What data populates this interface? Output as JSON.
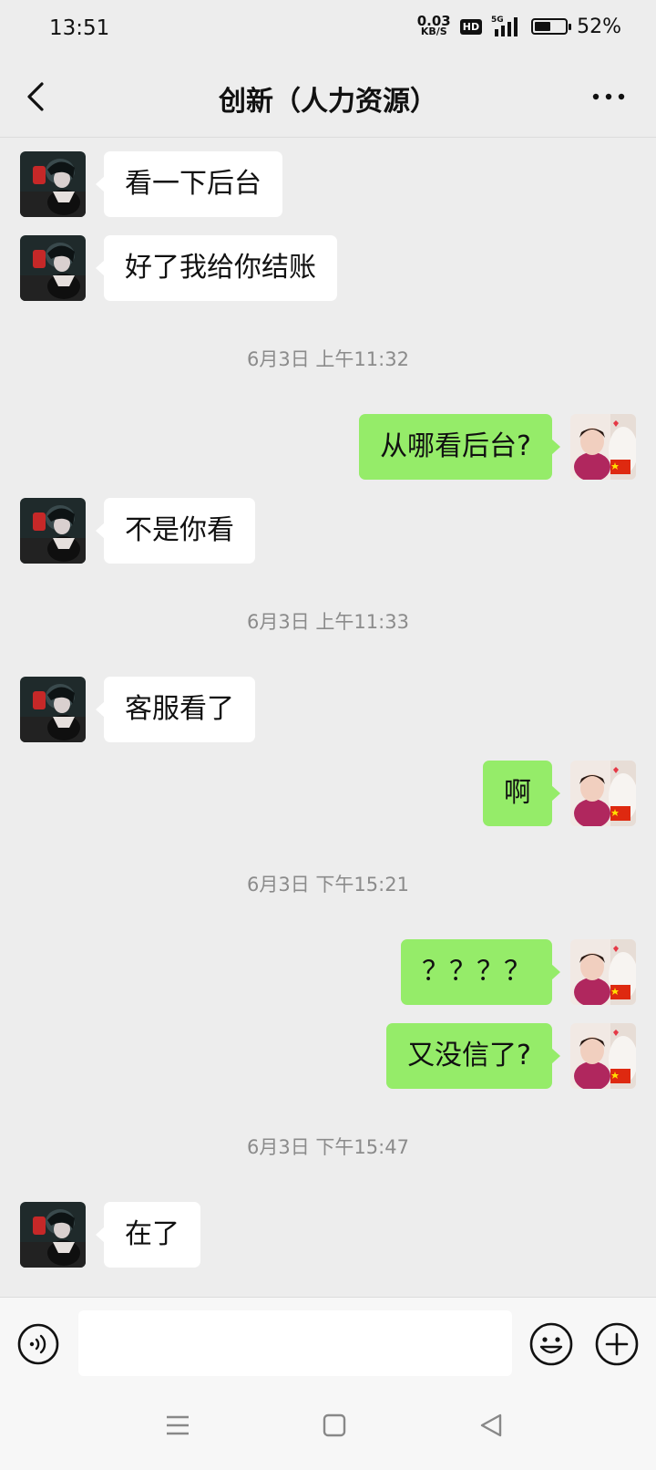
{
  "status_bar": {
    "time": "13:51",
    "net_speed_value": "0.03",
    "net_speed_unit": "KB/S",
    "hd_label": "HD",
    "network_label": "5G",
    "battery_percent": "52%",
    "battery_level": 0.52
  },
  "header": {
    "title": "创新（人力资源）"
  },
  "colors": {
    "background": "#ededed",
    "incoming_bubble": "#ffffff",
    "outgoing_bubble": "#95ec69",
    "timestamp_text": "#8b8b8b"
  },
  "messages": [
    {
      "kind": "incoming",
      "text": "看一下后台"
    },
    {
      "kind": "incoming",
      "text": "好了我给你结账"
    },
    {
      "kind": "timestamp",
      "text": "6月3日 上午11:32"
    },
    {
      "kind": "outgoing",
      "text": "从哪看后台?"
    },
    {
      "kind": "incoming",
      "text": "不是你看"
    },
    {
      "kind": "timestamp",
      "text": "6月3日 上午11:33"
    },
    {
      "kind": "incoming",
      "text": "客服看了"
    },
    {
      "kind": "outgoing",
      "text": "啊"
    },
    {
      "kind": "timestamp",
      "text": "6月3日 下午15:21"
    },
    {
      "kind": "outgoing",
      "text": "？？？？"
    },
    {
      "kind": "outgoing",
      "text": "又没信了?"
    },
    {
      "kind": "timestamp",
      "text": "6月3日 下午15:47"
    },
    {
      "kind": "incoming",
      "text": "在了"
    }
  ],
  "input_bar": {
    "placeholder": "",
    "voice_icon": "voice-icon",
    "emoji_icon": "emoji-icon",
    "plus_icon": "plus-icon"
  },
  "system_nav": {
    "icons": [
      "menu-icon",
      "home-icon",
      "back-triangle-icon"
    ]
  }
}
